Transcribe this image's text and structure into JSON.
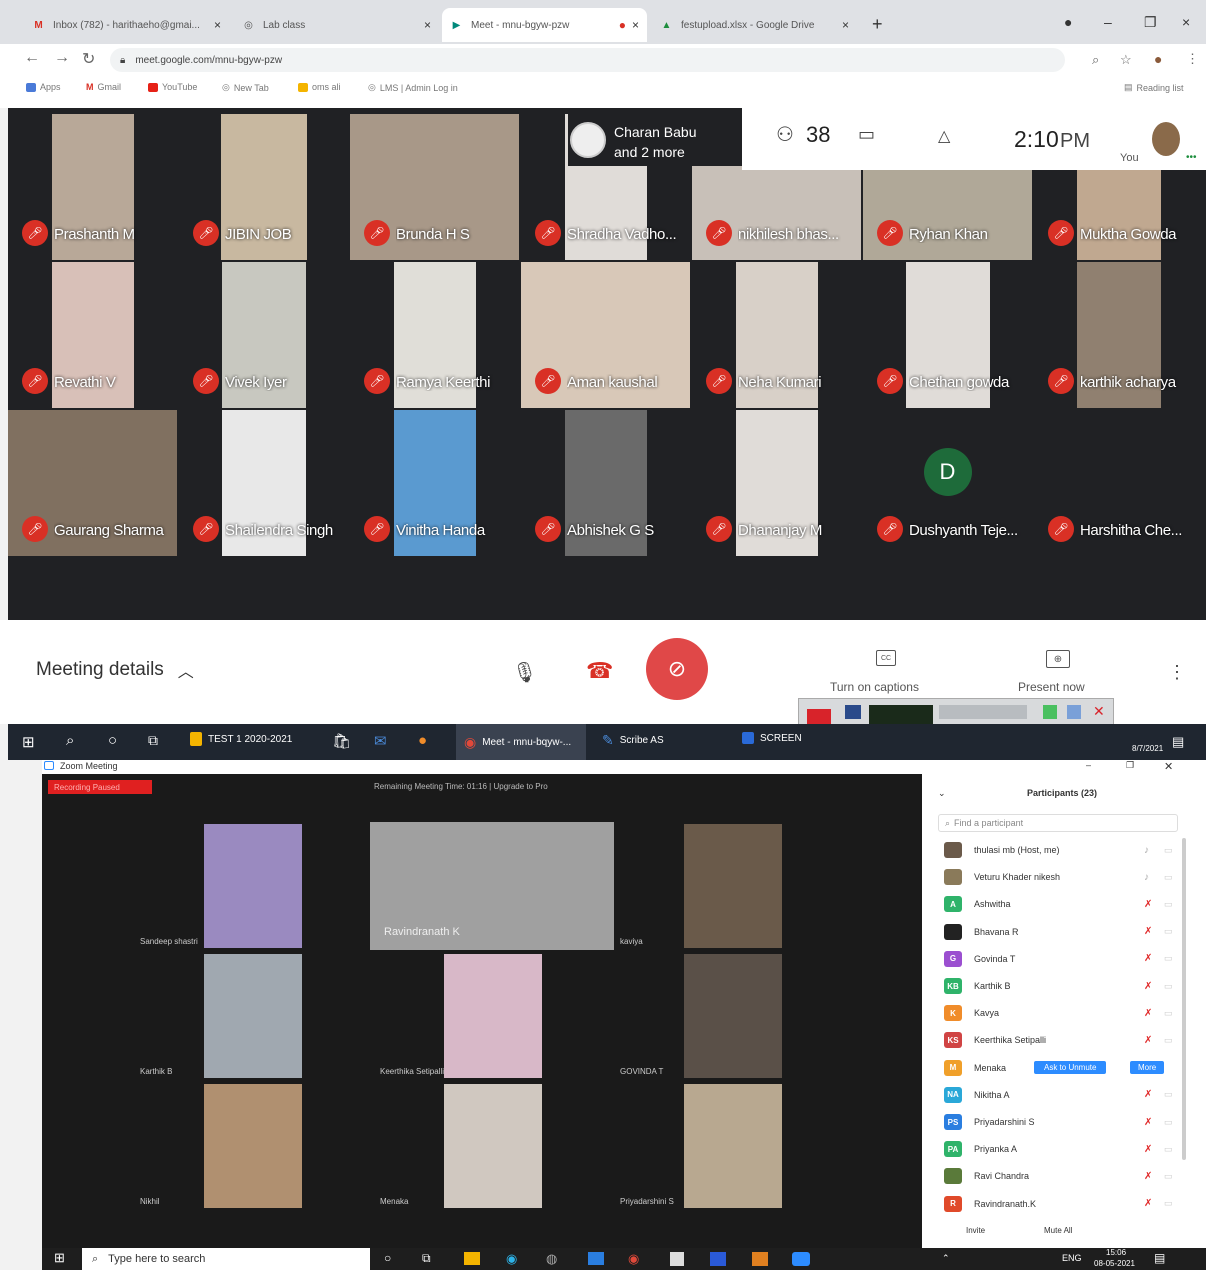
{
  "browser": {
    "tabs": [
      {
        "title": "Inbox (782) - harithaeho@gmai..."
      },
      {
        "title": "Lab class"
      },
      {
        "title": "Meet - mnu-bgyw-pzw"
      },
      {
        "title": "festupload.xlsx - Google Drive"
      }
    ],
    "url": "meet.google.com/mnu-bgyw-pzw",
    "bookmarks": [
      "Apps",
      "Gmail",
      "YouTube",
      "New Tab",
      "oms ali",
      "LMS | Admin Log in"
    ],
    "reading_list": "Reading list"
  },
  "meet": {
    "presenter_line1": "Charan Babu",
    "presenter_line2": "and 2 more",
    "participant_count": "38",
    "time": "2:10",
    "time_suffix": "PM",
    "you_label": "You",
    "meeting_details": "Meeting details",
    "captions_label": "Turn on captions",
    "present_label": "Present now",
    "cc_label": "CC",
    "avatar_letter": "D",
    "tiles": [
      "Prashanth M",
      "JIBIN JOB",
      "Brunda H S",
      "Shradha Vadho...",
      "nikhilesh bhas...",
      "Ryhan Khan",
      "Muktha Gowda",
      "Revathi V",
      "Vivek Iyer",
      "Ramya Keerthi",
      "Aman kaushal",
      "Neha Kumari",
      "Chethan gowda",
      "karthik acharya",
      "Gaurang Sharma",
      "Shailendra Singh",
      "Vinitha Handa",
      "Abhishek G S",
      "Dhananjay M",
      "Dushyanth Teje...",
      "Harshitha Che..."
    ]
  },
  "taskbar1": {
    "items": [
      "TEST 1 2020-2021",
      "Meet - mnu-bqyw-...",
      "Scribe AS",
      "SCREEN"
    ],
    "date": "8/7/2021"
  },
  "zoom": {
    "title": "Zoom Meeting",
    "recording": "Recording Paused",
    "remaining": "Remaining Meeting Time: 01:16 | Upgrade to Pro",
    "tiles": [
      "Sandeep shastri",
      "Ravindranath K",
      "kaviya",
      "Karthik B",
      "Keerthika Setipalli",
      "GOVINDA T",
      "Nikhil",
      "Menaka",
      "Priyadarshini S"
    ],
    "participants_title": "Participants (23)",
    "search_placeholder": "Find a participant",
    "participants": [
      {
        "initials": "",
        "name": "thulasi mb (Host, me)",
        "color": "#6b5a4a"
      },
      {
        "initials": "",
        "name": "Veturu Khader nikesh",
        "color": "#8a7a5a"
      },
      {
        "initials": "A",
        "name": "Ashwitha",
        "color": "#2fb36a"
      },
      {
        "initials": "",
        "name": "Bhavana R",
        "color": "#222222"
      },
      {
        "initials": "G",
        "name": "Govinda T",
        "color": "#9b4fd0"
      },
      {
        "initials": "KB",
        "name": "Karthik B",
        "color": "#2fb36a"
      },
      {
        "initials": "K",
        "name": "Kavya",
        "color": "#f08c2a"
      },
      {
        "initials": "KS",
        "name": "Keerthika Setipalli",
        "color": "#d04444"
      },
      {
        "initials": "M",
        "name": "Menaka",
        "color": "#f0a02a"
      },
      {
        "initials": "NA",
        "name": "Nikitha A",
        "color": "#2aa8d8"
      },
      {
        "initials": "PS",
        "name": "Priyadarshini S",
        "color": "#2a7ee0"
      },
      {
        "initials": "PA",
        "name": "Priyanka A",
        "color": "#2fb36a"
      },
      {
        "initials": "",
        "name": "Ravi Chandra",
        "color": "#5a7a3a"
      },
      {
        "initials": "R",
        "name": "Ravindranath.K",
        "color": "#e04a2a"
      }
    ],
    "ask_unmute": "Ask to Unmute",
    "more": "More",
    "invite": "Invite",
    "mute_all": "Mute All"
  },
  "taskbar2": {
    "search": "Type here to search",
    "lang": "ENG",
    "time": "15:06",
    "date": "08-05-2021"
  }
}
